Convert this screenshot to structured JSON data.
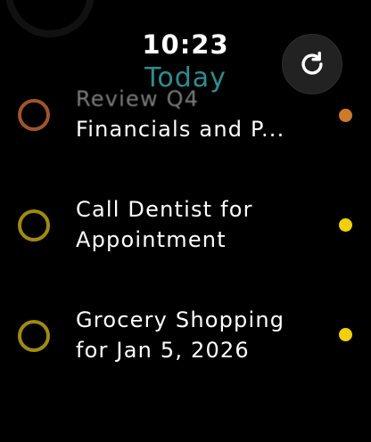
{
  "header": {
    "time": "10:23",
    "title": "Today"
  },
  "refresh_button": {
    "icon": "refresh-icon"
  },
  "tasks": [
    {
      "line1": "Review Q4",
      "line2": "Financials and P...",
      "ring_color": "#a0542a",
      "dot_color": "#cf7a2a"
    },
    {
      "line1": "Call Dentist for",
      "line2": "Appointment",
      "ring_color": "#a08a10",
      "dot_color": "#f2cf0a"
    },
    {
      "line1": "Grocery Shopping",
      "line2": "for Jan 5, 2026",
      "ring_color": "#a08a10",
      "dot_color": "#f2cf0a"
    }
  ],
  "colors": {
    "background": "#000000",
    "accent_title": "#2e8c90"
  }
}
